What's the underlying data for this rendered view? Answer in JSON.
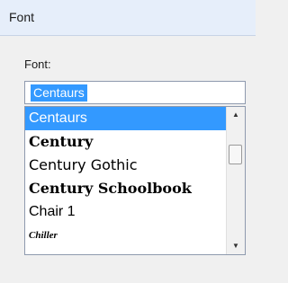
{
  "window": {
    "title": "Font"
  },
  "font_field": {
    "label": "Font:",
    "value": "Centaurs"
  },
  "font_list": {
    "items": [
      {
        "label": "Centaurs",
        "selected": true
      },
      {
        "label": "Century",
        "selected": false
      },
      {
        "label": "Century Gothic",
        "selected": false
      },
      {
        "label": "Century Schoolbook",
        "selected": false
      },
      {
        "label": "Chair 1",
        "selected": false
      },
      {
        "label": "Chiller",
        "selected": false
      }
    ],
    "scroll_up_icon": "▲",
    "scroll_down_icon": "▼"
  },
  "colors": {
    "selection": "#3399ff",
    "titlebar": "#e6eefa",
    "background": "#f0f0f0"
  }
}
